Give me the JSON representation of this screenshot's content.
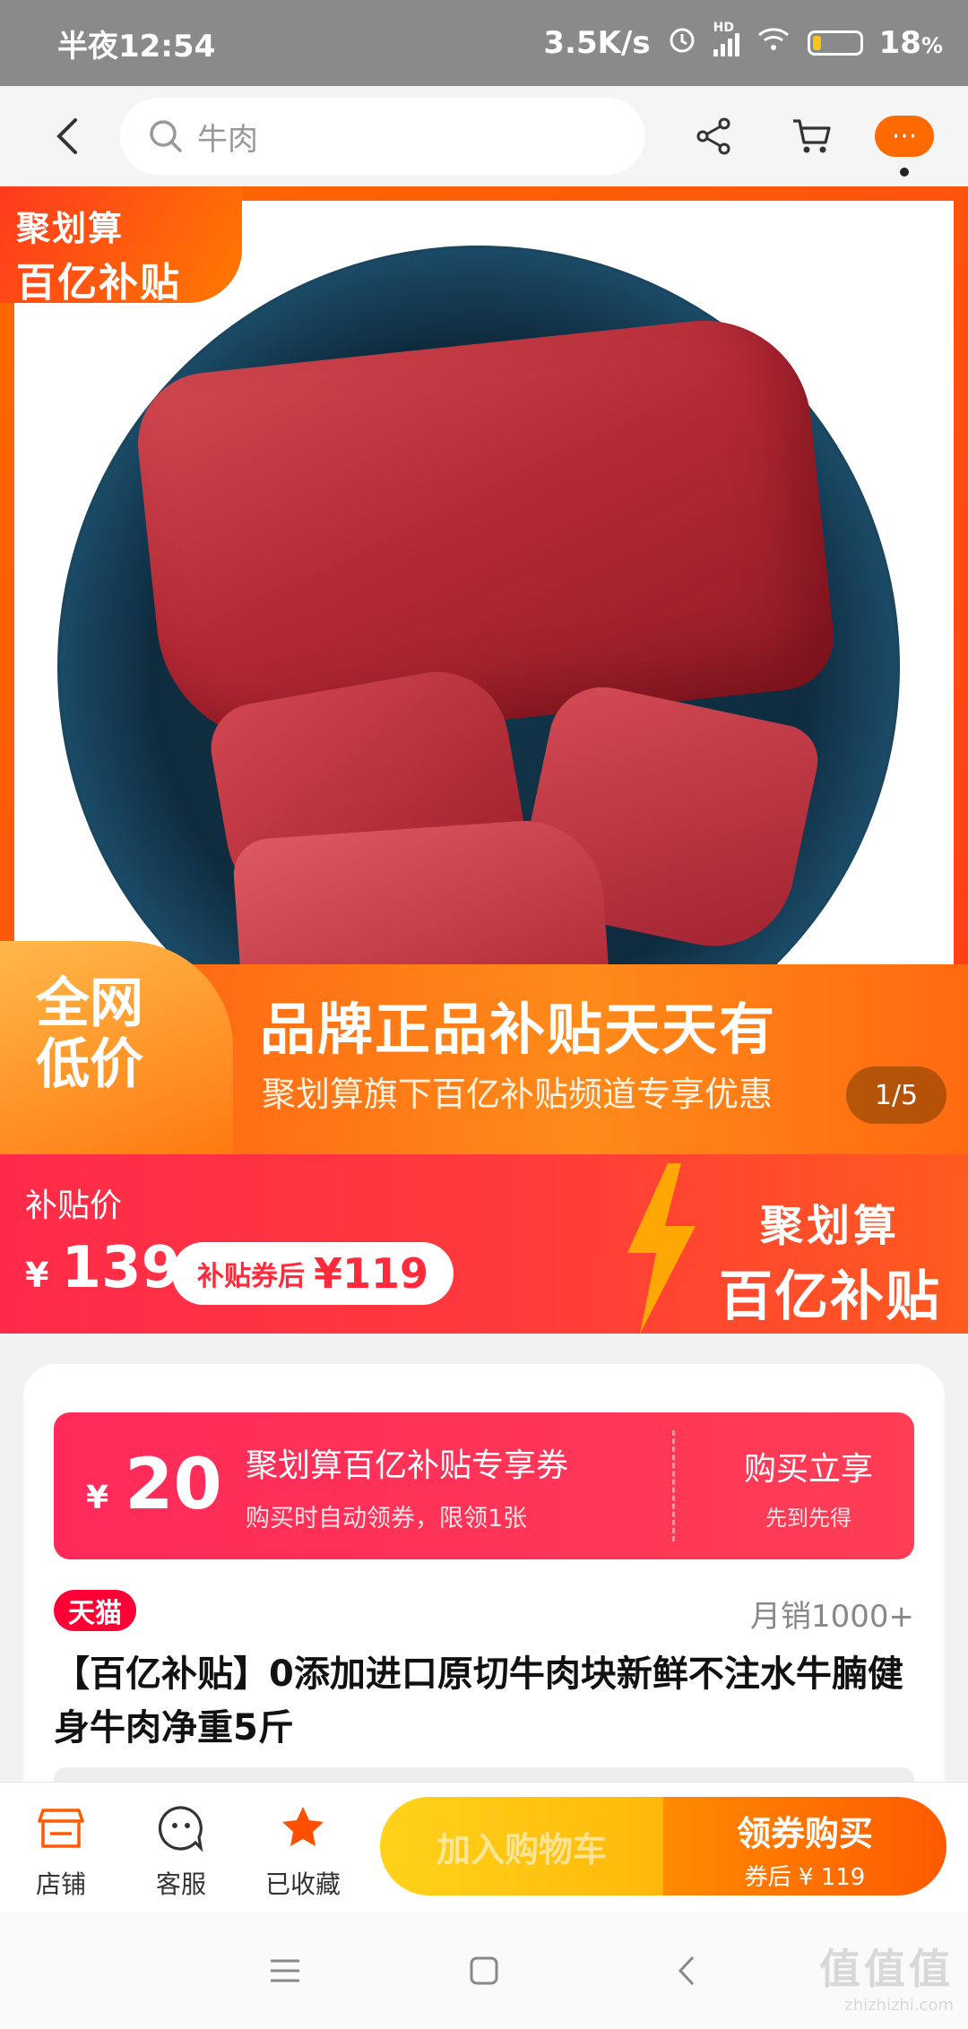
{
  "status_bar": {
    "time": "半夜12:54",
    "net_speed": "3.5K/s",
    "hd": "HD",
    "battery": "18",
    "battery_unit": "%",
    "battery_level": 0.18
  },
  "nav": {
    "search_text": "牛肉",
    "more_dots": "···",
    "icons": [
      "back-icon",
      "search-icon",
      "share-icon",
      "cart-icon",
      "more-icon"
    ]
  },
  "hero": {
    "badge_line1": "聚划算",
    "badge_line2": "百亿补贴",
    "promo_left": "全网\n低价",
    "promo_title": "品牌正品补贴天天有",
    "promo_sub": "聚划算旗下百亿补贴频道专享优惠",
    "pager": "1/5"
  },
  "price": {
    "label": "补贴价",
    "currency": "¥",
    "value": "139",
    "coupon_after_label": "补贴券后",
    "coupon_after_value": "¥119",
    "brand_line1": "聚划算",
    "brand_line2": "百亿补贴"
  },
  "coupon": {
    "currency": "¥",
    "amount": "20",
    "title": "聚划算百亿补贴专享券",
    "desc": "购买时自动领券，限领1张",
    "cta": "购买立享",
    "cta_sub": "先到先得"
  },
  "product": {
    "badge": "天猫",
    "sales": "月销1000+",
    "title": "【百亿补贴】0添加进口原切牛肉块新鲜不注水牛腩健身牛肉净重5斤"
  },
  "action_bar": {
    "store": "店铺",
    "service": "客服",
    "favorited": "已收藏",
    "add_cart": "加入购物车",
    "buy": "领券购买",
    "buy_sub": "券后 ¥ 119",
    "colors": {
      "accent": "#ff5a00",
      "star": "#ff5000",
      "cart_btn": "#ffc20e"
    }
  },
  "watermark": {
    "line1": "值值值",
    "line2": "zhizhizhi.com"
  }
}
